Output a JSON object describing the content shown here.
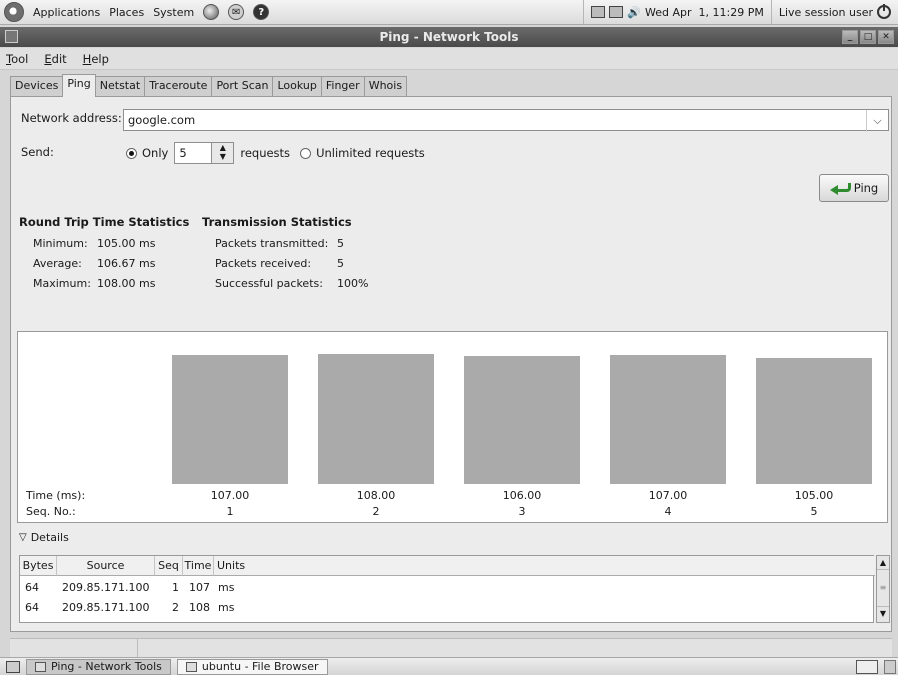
{
  "top_panel": {
    "menus": [
      "Applications",
      "Places",
      "System"
    ],
    "clock": "Wed Apr  1, 11:29 PM",
    "user": "Live session user"
  },
  "window": {
    "title": "Ping - Network Tools",
    "menu": [
      "Tool",
      "Edit",
      "Help"
    ],
    "tabs": [
      "Devices",
      "Ping",
      "Netstat",
      "Traceroute",
      "Port Scan",
      "Lookup",
      "Finger",
      "Whois"
    ],
    "active_tab": "Ping"
  },
  "form": {
    "network_label": "Network address:",
    "network_value": "google.com",
    "send_label": "Send:",
    "only_label": "Only",
    "count": "5",
    "requests_label": "requests",
    "unlimited_label": "Unlimited requests",
    "ping_button": "Ping"
  },
  "rtt": {
    "title": "Round Trip Time Statistics",
    "min_label": "Minimum:",
    "min_value": "105.00 ms",
    "avg_label": "Average:",
    "avg_value": "106.67 ms",
    "max_label": "Maximum:",
    "max_value": "108.00 ms"
  },
  "transmission": {
    "title": "Transmission Statistics",
    "sent_label": "Packets transmitted:",
    "sent_value": "5",
    "recv_label": "Packets received:",
    "recv_value": "5",
    "success_label": "Successful packets:",
    "success_value": "100%"
  },
  "chart_data": {
    "type": "bar",
    "xlabel": "Time (ms):",
    "seq_label": "Seq. No.:",
    "categories": [
      "1",
      "2",
      "3",
      "4",
      "5"
    ],
    "values": [
      107.0,
      108.0,
      106.0,
      107.0,
      105.0
    ],
    "value_labels": [
      "107.00",
      "108.00",
      "106.00",
      "107.00",
      "105.00"
    ],
    "bar_color": "#aaaaaa"
  },
  "details": {
    "label": "Details",
    "columns": [
      "Bytes",
      "Source",
      "Seq",
      "Time",
      "Units"
    ],
    "rows": [
      [
        "64",
        "209.85.171.100",
        "1",
        "107",
        "ms"
      ],
      [
        "64",
        "209.85.171.100",
        "2",
        "108",
        "ms"
      ]
    ]
  },
  "taskbar": {
    "items": [
      "Ping - Network Tools",
      "ubuntu - File Browser"
    ]
  }
}
